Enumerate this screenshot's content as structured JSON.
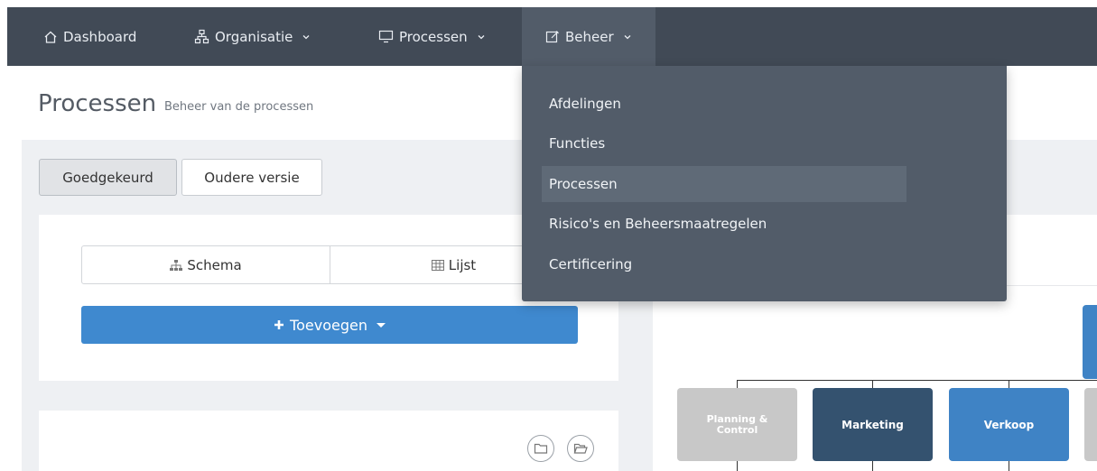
{
  "nav": {
    "items": [
      {
        "label": "Dashboard",
        "icon": "home-icon"
      },
      {
        "label": "Organisatie",
        "icon": "org-chart-icon"
      },
      {
        "label": "Processen",
        "icon": "monitor-icon"
      },
      {
        "label": "Beheer",
        "icon": "edit-icon"
      }
    ]
  },
  "dropdown": {
    "items": [
      {
        "label": "Afdelingen"
      },
      {
        "label": "Functies"
      },
      {
        "label": "Processen"
      },
      {
        "label": "Risico's en Beheersmaatregelen"
      },
      {
        "label": "Certificering"
      }
    ]
  },
  "page": {
    "title": "Processen",
    "subtitle": "Beheer van de processen"
  },
  "tabs": {
    "approved": "Goedgekeurd",
    "older": "Oudere versie"
  },
  "view_toggle": {
    "schema": "Schema",
    "list": "Lijst"
  },
  "add_button": {
    "label": "Toevoegen"
  },
  "org_chart": {
    "boxes": [
      {
        "label": "Planning & Control",
        "color": "#c8c8c8"
      },
      {
        "label": "Marketing",
        "color": "#34526f"
      },
      {
        "label": "Verkoop",
        "color": "#3f83c5"
      }
    ]
  },
  "colors": {
    "topbar": "#414a56",
    "dropdown": "#525c69",
    "primary": "#3f89cf"
  }
}
